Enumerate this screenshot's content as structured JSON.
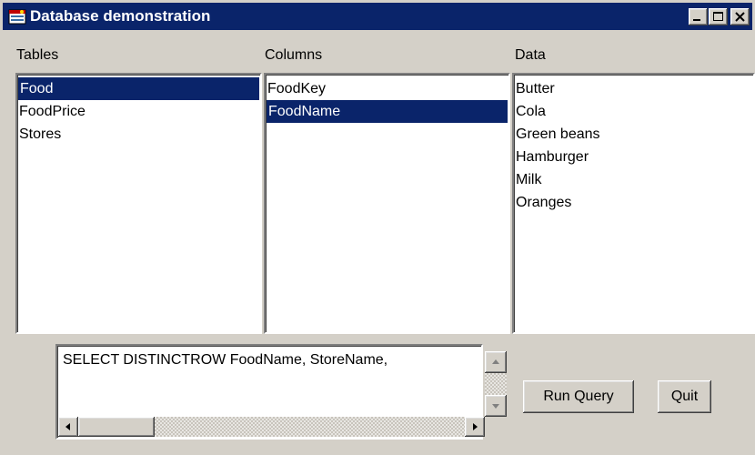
{
  "window": {
    "title": "Database demonstration"
  },
  "window_buttons": [
    "minimize-icon",
    "maximize-icon",
    "close-icon"
  ],
  "panels": {
    "tables": {
      "label": "Tables",
      "items": [
        "Food",
        "FoodPrice",
        "Stores"
      ],
      "selected": "Food"
    },
    "columns": {
      "label": "Columns",
      "items": [
        "FoodKey",
        "FoodName"
      ],
      "selected": "FoodName"
    },
    "data": {
      "label": "Data",
      "items": [
        "Butter",
        "Cola",
        "Green beans",
        "Hamburger",
        "Milk",
        "Oranges"
      ]
    }
  },
  "query": {
    "text": "SELECT DISTINCTROW FoodName, StoreName,"
  },
  "buttons": {
    "run_query": "Run Query",
    "quit": "Quit"
  },
  "colors": {
    "title_bar": "#0a246a",
    "selection": "#0a246a",
    "face": "#d4d0c8"
  }
}
